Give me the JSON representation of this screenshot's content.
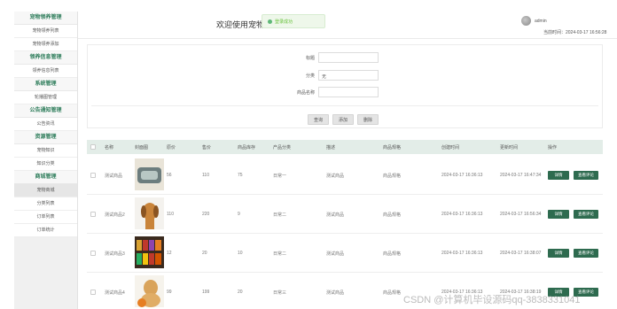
{
  "sidebar": {
    "sections": [
      {
        "title": "宠物领养管理",
        "items": [
          "宠物领养列表",
          "宠物领养添加"
        ]
      },
      {
        "title": "领养信息管理",
        "items": [
          "领养信息列表"
        ]
      },
      {
        "title": "系统管理",
        "items": [
          "轮播图管理"
        ]
      },
      {
        "title": "公告通知管理",
        "items": [
          "公告资讯"
        ]
      },
      {
        "title": "资源管理",
        "items": [
          "宠物知识",
          "知识分类"
        ]
      },
      {
        "title": "商城管理",
        "items": [
          "宠物商城",
          "分类列表",
          "订单列表",
          "订单统计"
        ]
      }
    ]
  },
  "header": {
    "welcome": "欢迎使用宠物-",
    "notice": "登录成功",
    "username": "admin",
    "time_label": "当前时间：2024-03-17 16:56:28"
  },
  "search": {
    "fields": [
      {
        "label": "标题",
        "value": ""
      },
      {
        "label": "分类",
        "value": "无"
      },
      {
        "label": "商品名称",
        "value": ""
      }
    ],
    "buttons": [
      "查询",
      "添加",
      "删除"
    ]
  },
  "table": {
    "headers": [
      "",
      "名称",
      "封面图",
      "原价",
      "售价",
      "商品库存",
      "产品分类",
      "描述",
      "商品规格",
      "创建时间",
      "更新时间",
      "操作"
    ],
    "rows": [
      {
        "name": "测试商品",
        "thumb": "pet-bed-image",
        "orig": "56",
        "price": "110",
        "stock": "75",
        "category": "日常一",
        "desc": "测试商品",
        "spec": "商品规格",
        "created": "2024-03-17 16:36:13",
        "updated": "2024-03-17 16:47:34",
        "actions": [
          "详情",
          "查看评论"
        ]
      },
      {
        "name": "测试商品2",
        "thumb": "dog-image",
        "orig": "110",
        "price": "220",
        "stock": "9",
        "category": "日常二",
        "desc": "测试商品",
        "spec": "商品规格",
        "created": "2024-03-17 16:36:13",
        "updated": "2024-03-17 16:56:34",
        "actions": [
          "详情",
          "查看评论"
        ]
      },
      {
        "name": "测试商品3",
        "thumb": "pet-food-image",
        "orig": "12",
        "price": "20",
        "stock": "10",
        "category": "日常二",
        "desc": "测试商品",
        "spec": "商品规格",
        "created": "2024-03-17 16:36:13",
        "updated": "2024-03-17 16:38:07",
        "actions": [
          "详情",
          "查看评论"
        ]
      },
      {
        "name": "测试商品4",
        "thumb": "golden-dog-image",
        "orig": "99",
        "price": "199",
        "stock": "20",
        "category": "日常三",
        "desc": "测试商品",
        "spec": "商品规格",
        "created": "2024-03-17 16:36:13",
        "updated": "2024-03-17 16:38:19",
        "actions": [
          "详情",
          "查看评论"
        ]
      }
    ]
  },
  "watermark": "CSDN @计算机毕设源码qq-3838331041"
}
